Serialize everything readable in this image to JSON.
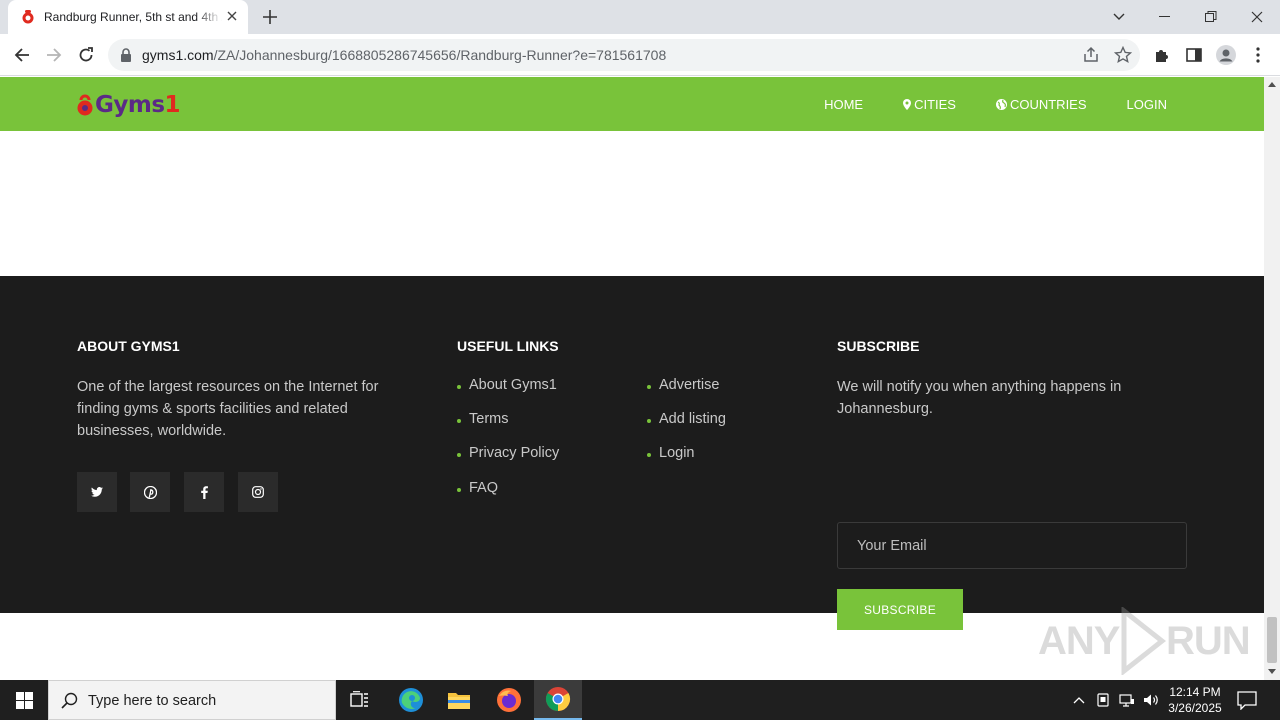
{
  "browser": {
    "tab_title": "Randburg Runner, 5th st and 4th Ave",
    "url_host": "gyms1.com",
    "url_path": "/ZA/Johannesburg/1668805286745656/Randburg-Runner?e=781561708"
  },
  "site": {
    "logo_text": "Gyms",
    "logo_suffix": "1",
    "nav": [
      {
        "label": "HOME",
        "icon": null
      },
      {
        "label": "CITIES",
        "icon": "map-marker-icon"
      },
      {
        "label": "COUNTRIES",
        "icon": "globe-icon"
      },
      {
        "label": "LOGIN",
        "icon": null
      }
    ]
  },
  "footer": {
    "about": {
      "title": "ABOUT GYMS1",
      "text": "One of the largest resources on the Internet for finding gyms & sports facilities and related businesses, worldwide.",
      "social": [
        "twitter-icon",
        "pinterest-icon",
        "facebook-icon",
        "instagram-icon"
      ]
    },
    "links": {
      "title": "USEFUL LINKS",
      "col1": [
        "About Gyms1",
        "Terms",
        "Privacy Policy",
        "FAQ"
      ],
      "col2": [
        "Advertise",
        "Add listing",
        "Login"
      ]
    },
    "subscribe": {
      "title": "SUBSCRIBE",
      "text": "We will notify you when anything happens in Johannesburg.",
      "placeholder": "Your Email",
      "button": "SUBSCRIBE"
    }
  },
  "watermark": {
    "left": "ANY",
    "right": "RUN"
  },
  "taskbar": {
    "search_placeholder": "Type here to search",
    "time": "12:14 PM",
    "date": "3/26/2025"
  },
  "colors": {
    "brand_green": "#79c33a",
    "footer_bg": "#1c1c1c",
    "logo_purple": "#5b2a86",
    "logo_red": "#e02a1f"
  }
}
